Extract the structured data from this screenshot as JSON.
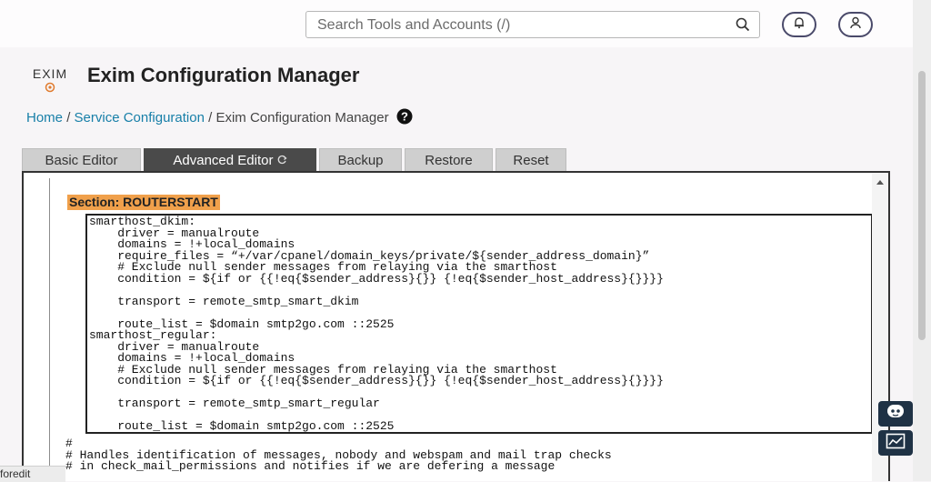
{
  "topbar": {
    "search_placeholder": "Search Tools and Accounts (/)",
    "notifications_icon": "bell-icon",
    "user_icon": "user-icon"
  },
  "header": {
    "logo_text": "EXIM",
    "title": "Exim Configuration Manager"
  },
  "breadcrumb": {
    "home": "Home",
    "sep1": "/",
    "service": "Service Configuration",
    "sep2": "/",
    "current": "Exim Configuration Manager"
  },
  "tabs": [
    {
      "label": "Basic Editor",
      "active": false
    },
    {
      "label": "Advanced Editor",
      "active": true
    },
    {
      "label": "Backup",
      "active": false
    },
    {
      "label": "Restore",
      "active": false
    },
    {
      "label": "Reset",
      "active": false
    }
  ],
  "editor": {
    "section_label": "Section: ROUTERSTART",
    "code": "smarthost_dkim:\n    driver = manualroute\n    domains = !+local_domains\n    require_files = “+/var/cpanel/domain_keys/private/${sender_address_domain}”\n    # Exclude null sender messages from relaying via the smarthost\n    condition = ${if or {{!eq{$sender_address}{}} {!eq{$sender_host_address}{}}}}\n\n    transport = remote_smtp_smart_dkim\n\n    route_list = $domain smtp2go.com ::2525\nsmarthost_regular:\n    driver = manualroute\n    domains = !+local_domains\n    # Exclude null sender messages from relaying via the smarthost\n    condition = ${if or {{!eq{$sender_address}{}} {!eq{$sender_host_address}{}}}}\n\n    transport = remote_smtp_smart_regular\n\n    route_list = $domain smtp2go.com ::2525",
    "comment_lines": "#\n# Handles identification of messages, nobody and webspam and mail trap checks\n# in check_mail_permissions and notifies if we are defering a message"
  },
  "status_text": "foredit",
  "colors": {
    "accent_link": "#177fa8",
    "section_highlight": "#f0a04b",
    "active_tab": "#4a4a4a",
    "float_button": "#1f3245"
  }
}
